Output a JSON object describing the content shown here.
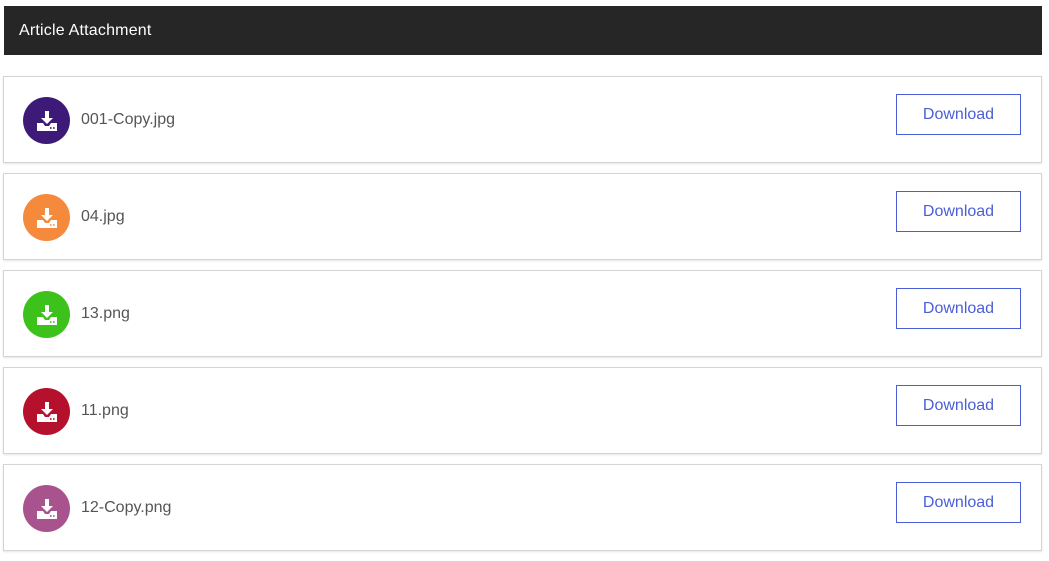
{
  "header": {
    "title": "Article Attachment"
  },
  "attachments": [
    {
      "filename": "001-Copy.jpg",
      "icon": "download-icon",
      "color": "#3d1a78",
      "button_label": "Download"
    },
    {
      "filename": "04.jpg",
      "icon": "download-icon",
      "color": "#f58a3c",
      "button_label": "Download"
    },
    {
      "filename": "13.png",
      "icon": "download-icon",
      "color": "#3cc21a",
      "button_label": "Download"
    },
    {
      "filename": "11.png",
      "icon": "download-icon",
      "color": "#b5112c",
      "button_label": "Download"
    },
    {
      "filename": "12-Copy.png",
      "icon": "download-icon",
      "color": "#a8538e",
      "button_label": "Download"
    }
  ],
  "colors": {
    "header_bg": "#262626",
    "button_accent": "#4a5fd6"
  }
}
